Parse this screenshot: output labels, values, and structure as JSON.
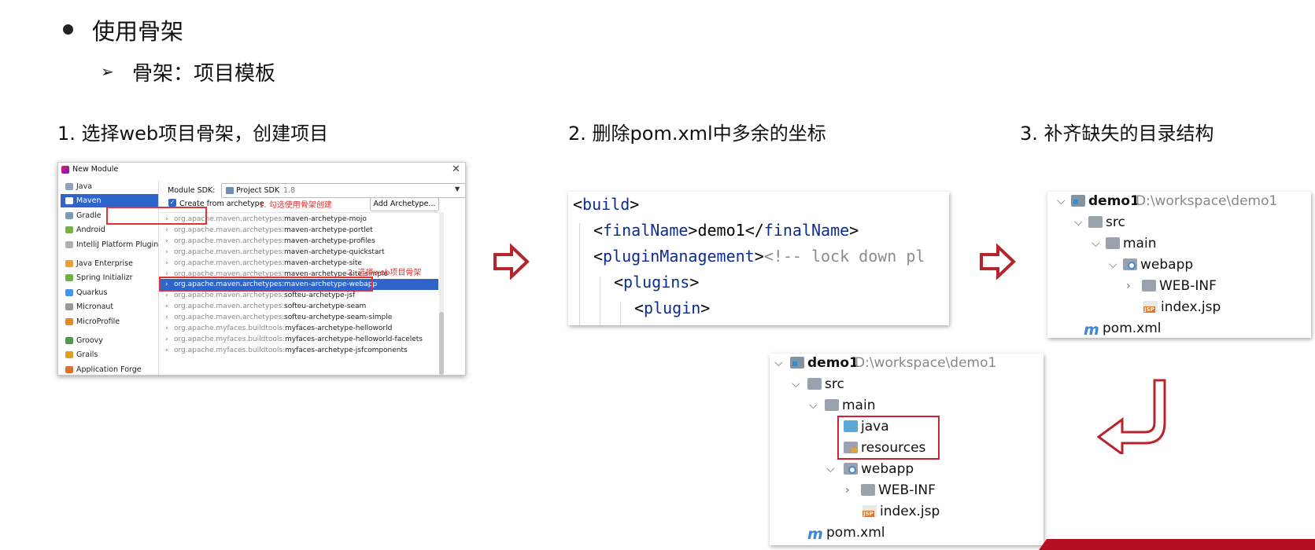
{
  "slide": {
    "heading": "使用骨架",
    "subheading": "骨架：项目模板",
    "steps": [
      "1. 选择web项目骨架，创建项目",
      "2. 删除pom.xml中多余的坐标",
      "3. 补齐缺失的目录结构"
    ]
  },
  "dialog": {
    "title": "New Module",
    "generators": [
      {
        "label": "Java",
        "icon": "java-icon",
        "color": "#8aa4c1"
      },
      {
        "label": "Maven",
        "icon": "maven-icon",
        "color": "#ffffff"
      },
      {
        "label": "Gradle",
        "icon": "gradle-icon",
        "color": "#7a9bb8"
      },
      {
        "label": "Android",
        "icon": "android-icon",
        "color": "#78b04a"
      },
      {
        "label": "IntelliJ Platform Plugin",
        "icon": "plugin-icon",
        "color": "#b0b0b0"
      },
      {
        "label": "Java Enterprise",
        "icon": "enterprise-icon",
        "color": "#f0a030"
      },
      {
        "label": "Spring Initializr",
        "icon": "spring-icon",
        "color": "#6db33f"
      },
      {
        "label": "Quarkus",
        "icon": "quarkus-icon",
        "color": "#4695eb"
      },
      {
        "label": "Micronaut",
        "icon": "micronaut-icon",
        "color": "#999999"
      },
      {
        "label": "MicroProfile",
        "icon": "microprofile-icon",
        "color": "#e08a30"
      },
      {
        "label": "Groovy",
        "icon": "groovy-icon",
        "color": "#4a9a4a"
      },
      {
        "label": "Grails",
        "icon": "grails-icon",
        "color": "#e0a020"
      },
      {
        "label": "Application Forge",
        "icon": "forge-icon",
        "color": "#e07030"
      }
    ],
    "sdk_label": "Module SDK:",
    "sdk_value": "Project SDK",
    "sdk_version": "1.8",
    "create_from_archetype": "Create from archetype",
    "annotation_1": "1. 勾选使用骨架创建",
    "add_archetype": "Add Archetype...",
    "annotation_2": "2. 选择web项目骨架",
    "archetypes": [
      {
        "group": "org.apache.maven.archetypes:",
        "artifact": "maven-archetype-mojo"
      },
      {
        "group": "org.apache.maven.archetypes:",
        "artifact": "maven-archetype-portlet"
      },
      {
        "group": "org.apache.maven.archetypes:",
        "artifact": "maven-archetype-profiles"
      },
      {
        "group": "org.apache.maven.archetypes:",
        "artifact": "maven-archetype-quickstart"
      },
      {
        "group": "org.apache.maven.archetypes:",
        "artifact": "maven-archetype-site"
      },
      {
        "group": "org.apache.maven.archetypes:",
        "artifact": "maven-archetype-site-simple"
      },
      {
        "group": "org.apache.maven.archetypes:",
        "artifact": "maven-archetype-webapp"
      },
      {
        "group": "org.apache.maven.archetypes:",
        "artifact": "softeu-archetype-jsf"
      },
      {
        "group": "org.apache.maven.archetypes:",
        "artifact": "softeu-archetype-seam"
      },
      {
        "group": "org.apache.maven.archetypes:",
        "artifact": "softeu-archetype-seam-simple"
      },
      {
        "group": "org.apache.myfaces.buildtools:",
        "artifact": "myfaces-archetype-helloworld"
      },
      {
        "group": "org.apache.myfaces.buildtools:",
        "artifact": "myfaces-archetype-helloworld-facelets"
      },
      {
        "group": "org.apache.myfaces.buildtools:",
        "artifact": "myfaces-archetype-jsfcomponents"
      }
    ],
    "selected_archetype": "maven-archetype-webapp"
  },
  "code": {
    "lines": [
      {
        "open": "<",
        "tag": "build",
        "close": ">",
        "text": "",
        "endtag": "",
        "comment": ""
      },
      {
        "open": "<",
        "tag": "finalName",
        "close": ">",
        "text": "demo1",
        "endtag": "finalName",
        "comment": ""
      },
      {
        "open": "<",
        "tag": "pluginManagement",
        "close": ">",
        "text": "",
        "endtag": "",
        "comment": "<!-- lock down pl"
      },
      {
        "open": "<",
        "tag": "plugins",
        "close": ">",
        "text": "",
        "endtag": "",
        "comment": ""
      },
      {
        "open": "<",
        "tag": "plugin",
        "close": ">",
        "text": "",
        "endtag": "",
        "comment": ""
      }
    ]
  },
  "tree_before": {
    "root": "demo1",
    "root_path": "D:\\workspace\\demo1",
    "src": "src",
    "main": "main",
    "webapp": "webapp",
    "webinf": "WEB-INF",
    "indexjsp": "index.jsp",
    "pom": "pom.xml"
  },
  "tree_after": {
    "root": "demo1",
    "root_path": "D:\\workspace\\demo1",
    "src": "src",
    "main": "main",
    "java": "java",
    "resources": "resources",
    "webapp": "webapp",
    "webinf": "WEB-INF",
    "indexjsp": "index.jsp",
    "pom": "pom.xml"
  },
  "colors": {
    "annotation_red": "#e23232",
    "selection_blue": "#2f65ca",
    "arrow_red": "#b8242c",
    "xml_tag": "#0d2c8e"
  }
}
